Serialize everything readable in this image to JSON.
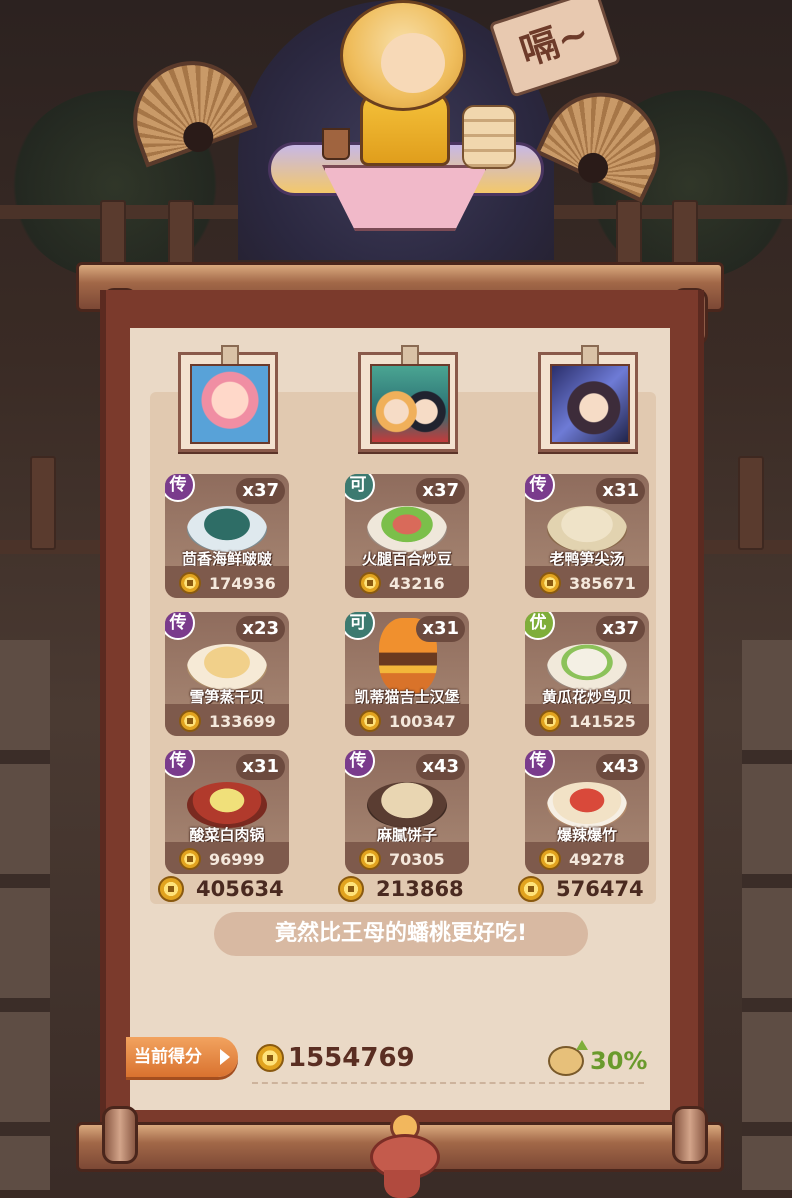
{
  "sign_text": "嗝~",
  "columns": [
    {
      "portrait": "character-portrait-pink-hair",
      "dishes": [
        {
          "badge": "传",
          "badge_type": "chuan",
          "qty": "x37",
          "name": "茴香海鲜啵啵",
          "price": "174936"
        },
        {
          "badge": "传",
          "badge_type": "chuan",
          "qty": "x23",
          "name": "雪笋蒸干贝",
          "price": "133699"
        },
        {
          "badge": "传",
          "badge_type": "chuan",
          "qty": "x31",
          "name": "酸菜白肉锅",
          "price": "96999"
        }
      ],
      "total": "405634"
    },
    {
      "portrait": "character-portrait-duo",
      "dishes": [
        {
          "badge": "可",
          "badge_type": "ke",
          "qty": "x37",
          "name": "火腿百合炒豆",
          "price": "43216"
        },
        {
          "badge": "可",
          "badge_type": "ke",
          "qty": "x31",
          "name": "凯蒂猫吉士汉堡",
          "price": "100347"
        },
        {
          "badge": "传",
          "badge_type": "chuan",
          "qty": "x43",
          "name": "麻腻饼子",
          "price": "70305"
        }
      ],
      "total": "213868"
    },
    {
      "portrait": "character-portrait-dark-hair",
      "dishes": [
        {
          "badge": "传",
          "badge_type": "chuan",
          "qty": "x31",
          "name": "老鸭笋尖汤",
          "price": "385671"
        },
        {
          "badge": "优",
          "badge_type": "you",
          "qty": "x37",
          "name": "黄瓜花炒鸟贝",
          "price": "141525"
        },
        {
          "badge": "传",
          "badge_type": "chuan",
          "qty": "x43",
          "name": "爆辣爆竹",
          "price": "49278"
        }
      ],
      "total": "576474"
    }
  ],
  "comment": "竟然比王母的蟠桃更好吃!",
  "score": {
    "label": "当前得分",
    "value": "1554769",
    "bonus": "30%"
  },
  "colors": {
    "scroll_frame": "#7b3a2c",
    "paper": "#ead9c6",
    "badge_chuan": "#7a3b8c",
    "badge_ke": "#3c7a70",
    "badge_you": "#7fae3a",
    "bonus_green": "#6a9a2c"
  }
}
